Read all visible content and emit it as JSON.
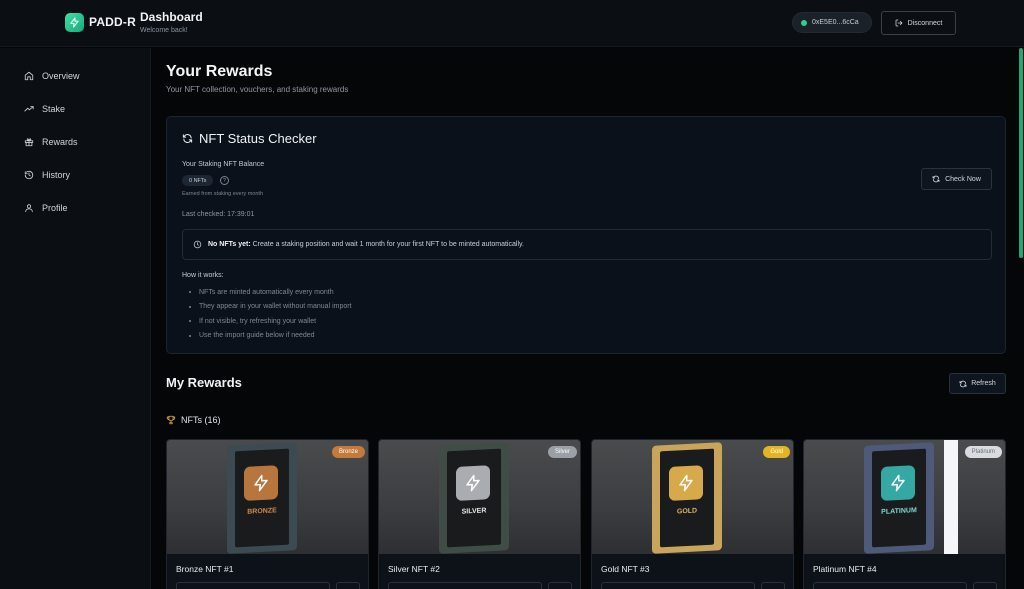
{
  "header": {
    "logo_text": "PADD-R",
    "title": "Dashboard",
    "subtitle": "Welcome back!",
    "wallet_address": "0xE5E0...6cCa",
    "disconnect_label": "Disconnect"
  },
  "sidebar": {
    "items": [
      {
        "label": "Overview",
        "icon": "home-icon"
      },
      {
        "label": "Stake",
        "icon": "trending-up-icon"
      },
      {
        "label": "Rewards",
        "icon": "gift-icon"
      },
      {
        "label": "History",
        "icon": "history-icon"
      },
      {
        "label": "Profile",
        "icon": "user-icon"
      }
    ]
  },
  "page": {
    "title": "Your Rewards",
    "subtitle": "Your NFT collection, vouchers, and staking rewards"
  },
  "status_checker": {
    "title": "NFT Status Checker",
    "balance_label": "Your Staking NFT Balance",
    "balance_value": "0 NFTs",
    "help_glyph": "?",
    "earned_note": "Earned from staking every month",
    "last_checked": "Last checked: 17:39:01",
    "check_button": "Check Now",
    "notice_bold": "No NFTs yet:",
    "notice_text": "Create a staking position and wait 1 month for your first NFT to be minted automatically.",
    "how_title": "How it works:",
    "how_items": [
      "NFTs are minted automatically every month",
      "They appear in your wallet without manual import",
      "If not visible, try refreshing your wallet",
      "Use the import guide below if needed"
    ]
  },
  "my_rewards": {
    "title": "My Rewards",
    "refresh_label": "Refresh",
    "nfts_label": "NFTs (16)"
  },
  "nfts": [
    {
      "name": "Bronze NFT #1",
      "badge": "Bronze",
      "tier_text": "BRONZE",
      "badge_color": "#c47a3a",
      "tile_color": "#b8763f",
      "frame_color": "#3c4a52"
    },
    {
      "name": "Silver NFT #2",
      "badge": "Silver",
      "tier_text": "SILVER",
      "badge_color": "#9aa0a6",
      "tile_color": "#a9adb2",
      "frame_color": "#3f4d46"
    },
    {
      "name": "Gold NFT #3",
      "badge": "Gold",
      "tier_text": "GOLD",
      "badge_color": "#e3b520",
      "tile_color": "#d6a94a",
      "frame_color": "#c9a55c"
    },
    {
      "name": "Platinum NFT #4",
      "badge": "Platinum",
      "tier_text": "PLATINUM",
      "badge_color": "#d8dbe0",
      "tile_color": "#35a8a3",
      "frame_color": "#4f5a7a"
    }
  ]
}
